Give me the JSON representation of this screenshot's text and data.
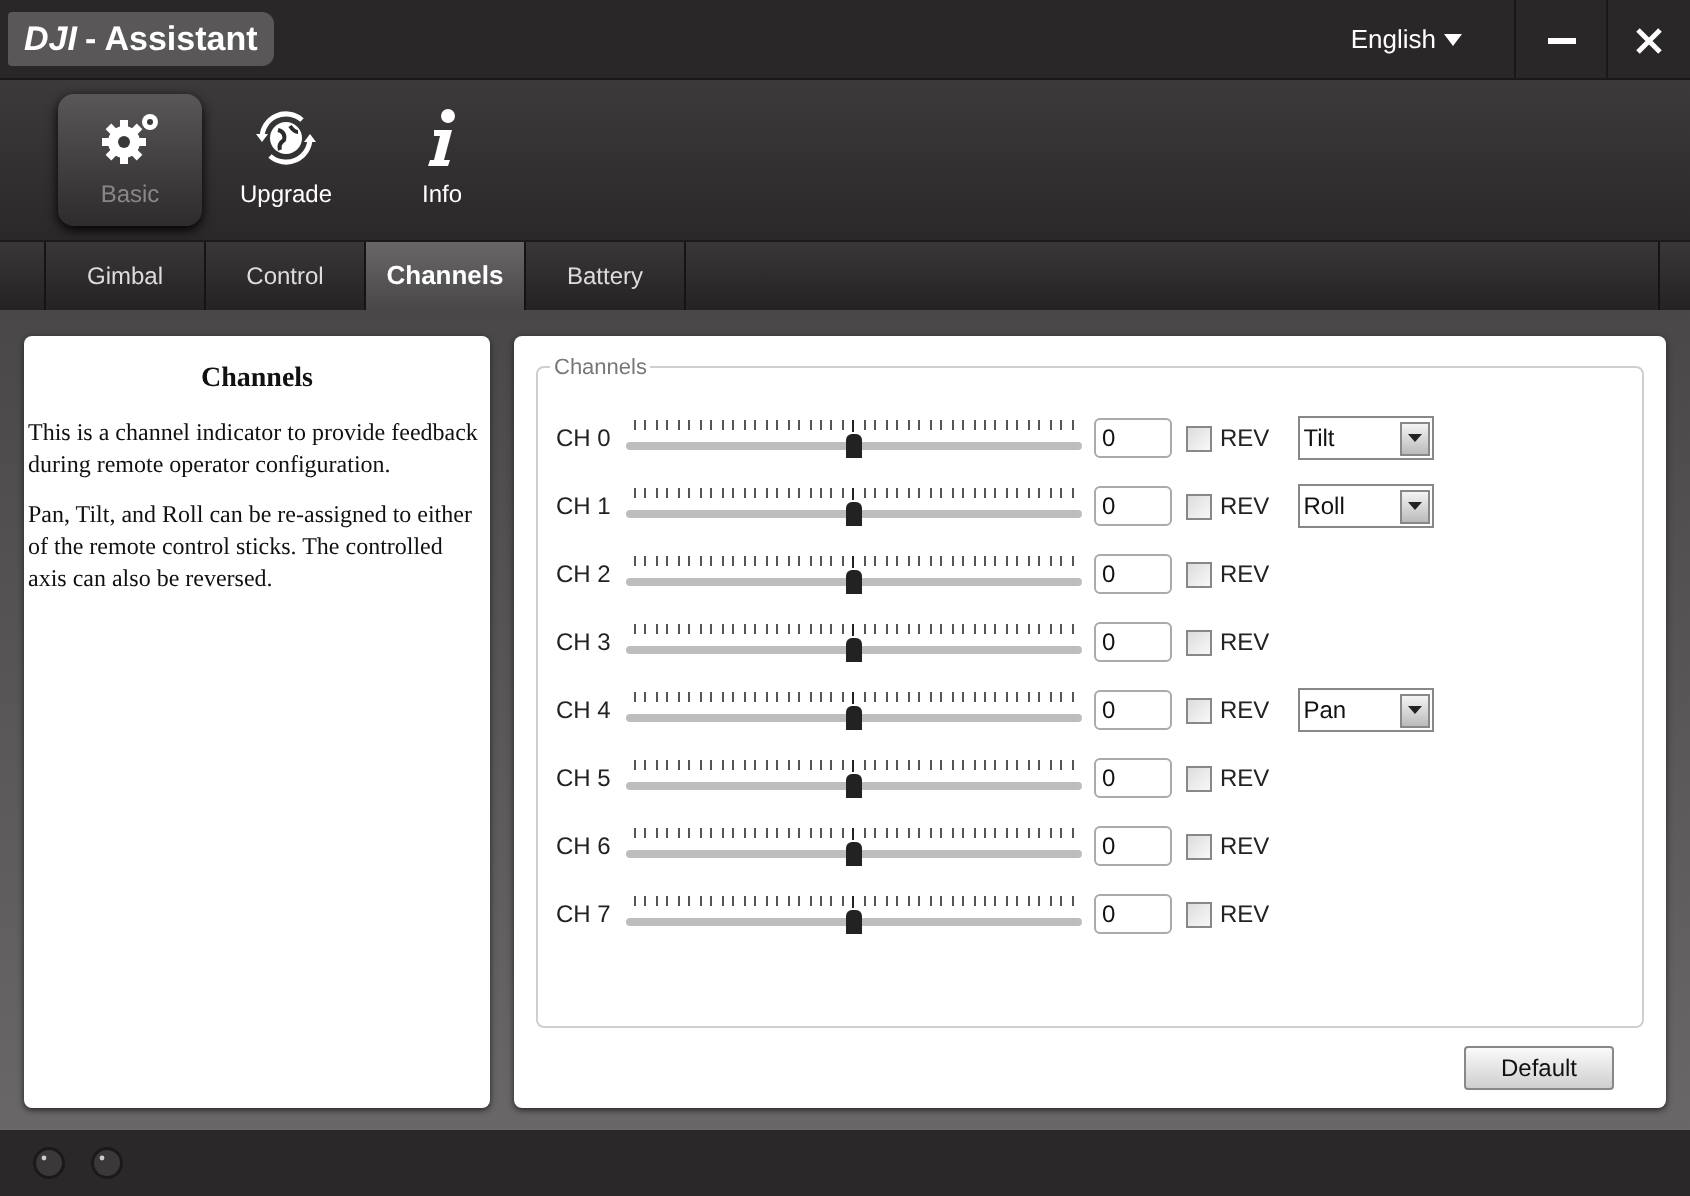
{
  "window": {
    "title_bold": "DJI",
    "title": "- Assistant",
    "language": "English"
  },
  "toolbar": [
    {
      "label": "Basic",
      "kind": "gear",
      "selected": true
    },
    {
      "label": "Upgrade",
      "kind": "globe",
      "selected": false
    },
    {
      "label": "Info",
      "kind": "info",
      "selected": false
    }
  ],
  "tabs": [
    {
      "label": "Gimbal",
      "selected": false
    },
    {
      "label": "Control",
      "selected": false
    },
    {
      "label": "Channels",
      "selected": true
    },
    {
      "label": "Battery",
      "selected": false
    }
  ],
  "help": {
    "title": "Channels",
    "paragraphs": [
      "This is a channel indicator to provide feedback during remote operator configuration.",
      "Pan, Tilt, and Roll can be re-assigned to either of the remote control sticks. The controlled axis can also be reversed."
    ]
  },
  "channels_group": {
    "title": "Channels",
    "rows": [
      {
        "label": "CH 0",
        "level": 0.5,
        "value": "0",
        "rev_label": "REV",
        "checked": false,
        "axis": "Tilt"
      },
      {
        "label": "CH 1",
        "level": 0.5,
        "value": "0",
        "rev_label": "REV",
        "checked": false,
        "axis": "Roll"
      },
      {
        "label": "CH 2",
        "level": 0.5,
        "value": "0",
        "rev_label": "REV",
        "checked": false
      },
      {
        "label": "CH 3",
        "level": 0.5,
        "value": "0",
        "rev_label": "REV",
        "checked": false
      },
      {
        "label": "CH 4",
        "level": 0.5,
        "value": "0",
        "rev_label": "REV",
        "checked": false,
        "axis": "Pan"
      },
      {
        "label": "CH 5",
        "level": 0.5,
        "value": "0",
        "rev_label": "REV",
        "checked": false
      },
      {
        "label": "CH 6",
        "level": 0.5,
        "value": "0",
        "rev_label": "REV",
        "checked": false
      },
      {
        "label": "CH 7",
        "level": 0.5,
        "value": "0",
        "rev_label": "REV",
        "checked": false
      }
    ]
  },
  "default_button": "Default"
}
